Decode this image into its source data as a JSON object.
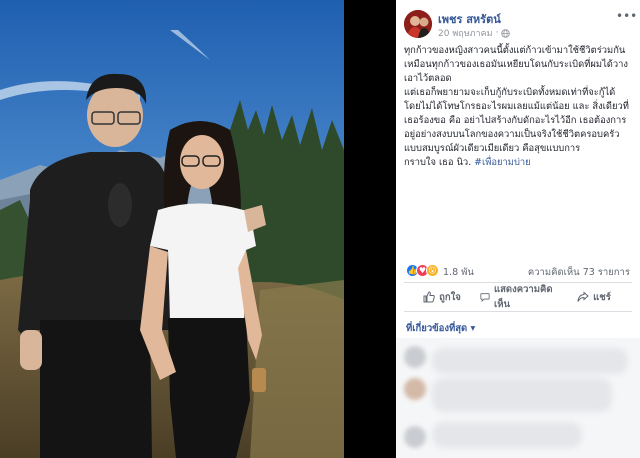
{
  "post": {
    "author": "เพชร สหรัตน์",
    "date": "20 พฤษภาคม",
    "paragraphs": [
      "ทุกก้าวของหญิงสาวคนนี้ตั้งแต่ก้าวเข้ามาใช้ชีวิตร่วมกันเหมือนทุกก้าวของเธอมันเหยียบโดนกับระเบิดที่ผมได้วางเอาไว้ตลอด",
      "แต่เธอก็พยายามจะเก็บกู้กับระเบิดทั้งหมดเท่าที่จะกู้ได้",
      "โดยไม่ได้โทษโกรธอะไรผมเลยแม้แต่น้อย และ สิ่งเดียวที่เธอร้องขอ คือ อย่าไปสร้างกับดักอะไรไว้อีก เธอต้องการอยู่อย่างสงบบนโลกของความเป็นจริงใช้ชีวิตครอบครัวแบบสมบูรณ์ผัวเดียวเมียเดียว คือสุขแบบการ"
    ],
    "closing": "กราบใจ เธอ นิว. ",
    "hashtag": "#เพื่อยามบ่าย"
  },
  "stats": {
    "reactions": "1.8 พัน",
    "comments": "ความคิดเห็น 73 รายการ"
  },
  "actions": {
    "like": "ถูกใจ",
    "comment": "แสดงความคิดเห็น",
    "share": "แชร์"
  },
  "comments_filter": "ที่เกี่ยวข้องที่สุด ▾",
  "icons": {
    "globe": "globe-icon",
    "more": "more-options-icon",
    "like": "thumbs-up-icon",
    "comment": "comment-bubble-icon",
    "share": "share-arrow-icon"
  },
  "colors": {
    "link": "#365899",
    "like_blue": "#1877f2",
    "love_red": "#f33e58",
    "wow_yellow": "#f7b125"
  }
}
